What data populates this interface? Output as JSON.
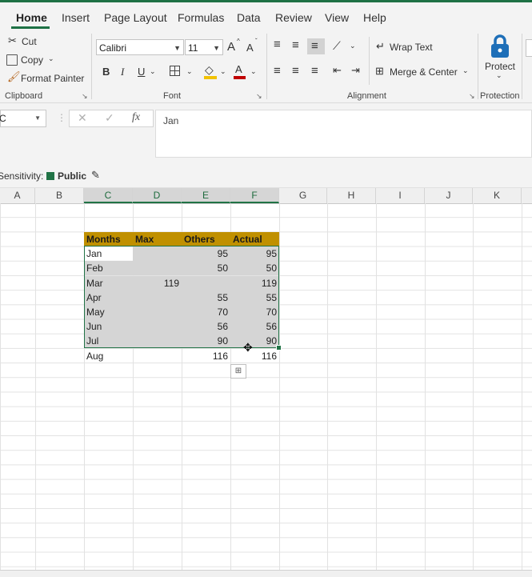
{
  "ribbon_tabs": [
    "Home",
    "Insert",
    "Page Layout",
    "Formulas",
    "Data",
    "Review",
    "View",
    "Help"
  ],
  "clipboard": {
    "cut": "Cut",
    "copy": "Copy",
    "format_painter": "Format Painter",
    "label": "Clipboard"
  },
  "font": {
    "name": "Calibri",
    "size": "11",
    "grow": "A",
    "shrink": "A",
    "bold": "B",
    "italic": "I",
    "underline": "U",
    "color_letter": "A",
    "label": "Font",
    "accent_fill": "#f2c200",
    "accent_font": "#c00000"
  },
  "alignment": {
    "wrap": "Wrap Text",
    "merge": "Merge & Center",
    "label": "Alignment"
  },
  "protection": {
    "protect": "Protect",
    "label": "Protection",
    "brand_color": "#1e6fb8"
  },
  "namebox": "C",
  "fx": "fx",
  "formula_value": "Jan",
  "sensitivity": {
    "label": "Sensitivity:",
    "value": "Public",
    "color": "#217346"
  },
  "columns": [
    "A",
    "B",
    "C",
    "D",
    "E",
    "F",
    "G",
    "H",
    "I",
    "J",
    "K"
  ],
  "table": {
    "headers": [
      "Months",
      "Max",
      "Others",
      "Actual"
    ],
    "rows": [
      [
        "Jan",
        "",
        "95",
        "95"
      ],
      [
        "Feb",
        "",
        "50",
        "50"
      ],
      [
        "Mar",
        "119",
        "",
        "119"
      ],
      [
        "Apr",
        "",
        "55",
        "55"
      ],
      [
        "May",
        "",
        "70",
        "70"
      ],
      [
        "Jun",
        "",
        "56",
        "56"
      ],
      [
        "Jul",
        "",
        "90",
        "90"
      ],
      [
        "Aug",
        "",
        "116",
        "116"
      ]
    ]
  },
  "header_fill": "#c09000",
  "selection_color": "#217346"
}
